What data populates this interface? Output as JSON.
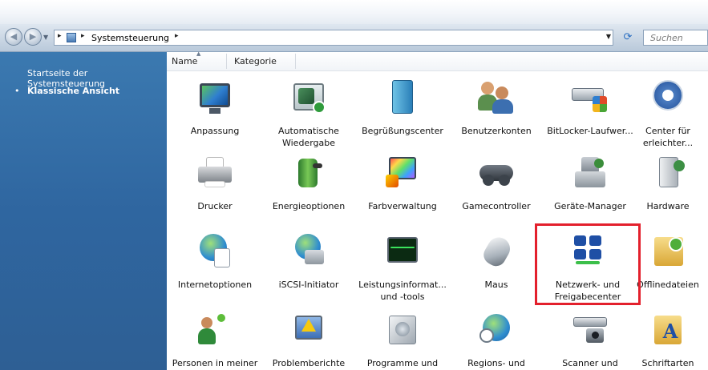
{
  "window": {
    "address": {
      "root_crumb": "Systemsteuerung",
      "separator": "▸"
    },
    "search": {
      "placeholder": "Suchen"
    }
  },
  "sidebar": {
    "items": [
      {
        "label": "Startseite der Systemsteuerung",
        "selected": false
      },
      {
        "label": "Klassische Ansicht",
        "selected": true
      }
    ]
  },
  "columns": [
    {
      "label": "Name",
      "sorted": true
    },
    {
      "label": "Kategorie",
      "sorted": false
    }
  ],
  "items": [
    {
      "label": "Anpassung",
      "icon": "display-personalization-icon"
    },
    {
      "label": "Automatische Wiedergabe",
      "icon": "autoplay-icon"
    },
    {
      "label": "Begrüßungscenter",
      "icon": "welcome-center-icon"
    },
    {
      "label": "Benutzerkonten",
      "icon": "user-accounts-icon"
    },
    {
      "label": "BitLocker-Laufwer...",
      "icon": "bitlocker-icon"
    },
    {
      "label": "Center für erleichter...",
      "icon": "ease-of-access-icon"
    },
    {
      "label": "Drucker",
      "icon": "printer-icon"
    },
    {
      "label": "Energieoptionen",
      "icon": "power-options-icon"
    },
    {
      "label": "Farbverwaltung",
      "icon": "color-management-icon"
    },
    {
      "label": "Gamecontroller",
      "icon": "game-controller-icon"
    },
    {
      "label": "Geräte-Manager",
      "icon": "device-manager-icon"
    },
    {
      "label": "Hardware",
      "icon": "hardware-icon"
    },
    {
      "label": "Internetoptionen",
      "icon": "internet-options-icon"
    },
    {
      "label": "iSCSI-Initiator",
      "icon": "iscsi-icon"
    },
    {
      "label": "Leistungsinformat... und -tools",
      "icon": "performance-icon"
    },
    {
      "label": "Maus",
      "icon": "mouse-icon"
    },
    {
      "label": "Netzwerk- und Freigabecenter",
      "icon": "network-sharing-icon",
      "highlighted": true
    },
    {
      "label": "Offlinedateien",
      "icon": "offline-files-icon"
    },
    {
      "label": "Personen in meiner",
      "icon": "people-near-me-icon"
    },
    {
      "label": "Problemberichte",
      "icon": "problem-reports-icon"
    },
    {
      "label": "Programme und",
      "icon": "programs-features-icon"
    },
    {
      "label": "Regions- und",
      "icon": "regional-options-icon"
    },
    {
      "label": "Scanner und",
      "icon": "scanners-cameras-icon"
    },
    {
      "label": "Schriftarten",
      "icon": "fonts-icon"
    }
  ],
  "colors": {
    "sidebar_bg": "#2f66a0",
    "highlight_border": "#e3202c"
  }
}
